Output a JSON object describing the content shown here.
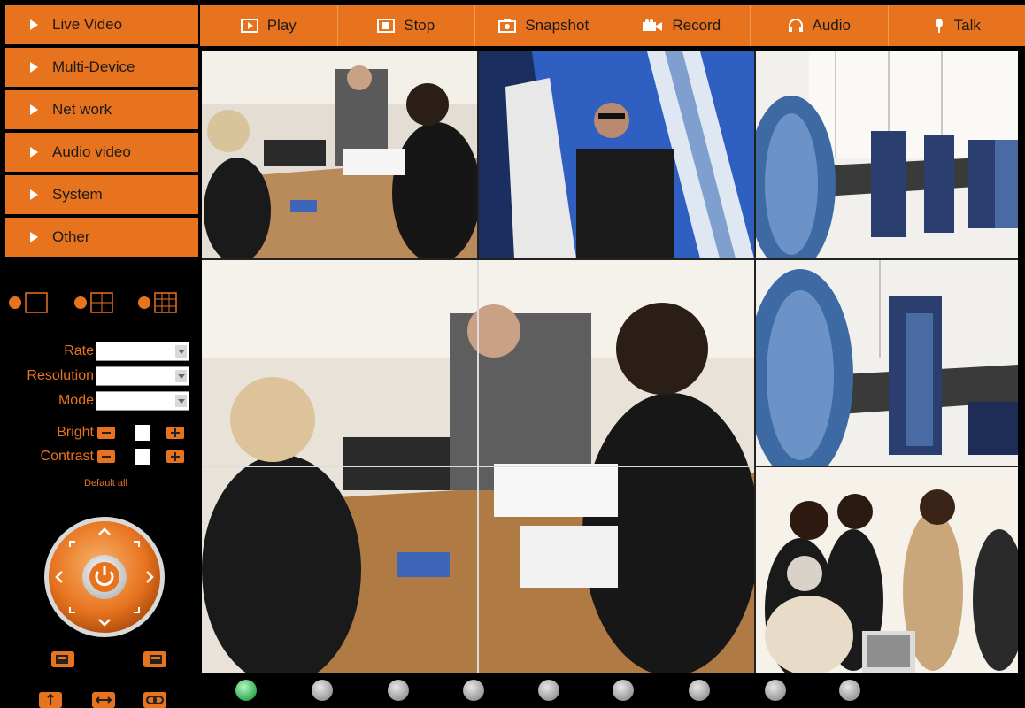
{
  "menu": [
    {
      "label": "Live Video"
    },
    {
      "label": "Multi-Device"
    },
    {
      "label": "Net work"
    },
    {
      "label": "Audio video"
    },
    {
      "label": "System"
    },
    {
      "label": "Other"
    }
  ],
  "toolbar": {
    "play": "Play",
    "stop": "Stop",
    "snapshot": "Snapshot",
    "record": "Record",
    "audio": "Audio",
    "talk": "Talk"
  },
  "layouts": [
    "single-view-icon",
    "quad-view-icon",
    "nine-view-icon"
  ],
  "settings": {
    "rate_label": "Rate",
    "resolution_label": "Resolution",
    "mode_label": "Mode",
    "bright_label": "Bright",
    "contrast_label": "Contrast",
    "default_all": "Default all"
  },
  "channels": {
    "count": 9,
    "active_index": 0
  },
  "colors": {
    "accent": "#e8731f",
    "background": "#000000",
    "channel_active": "#3cb35a"
  }
}
